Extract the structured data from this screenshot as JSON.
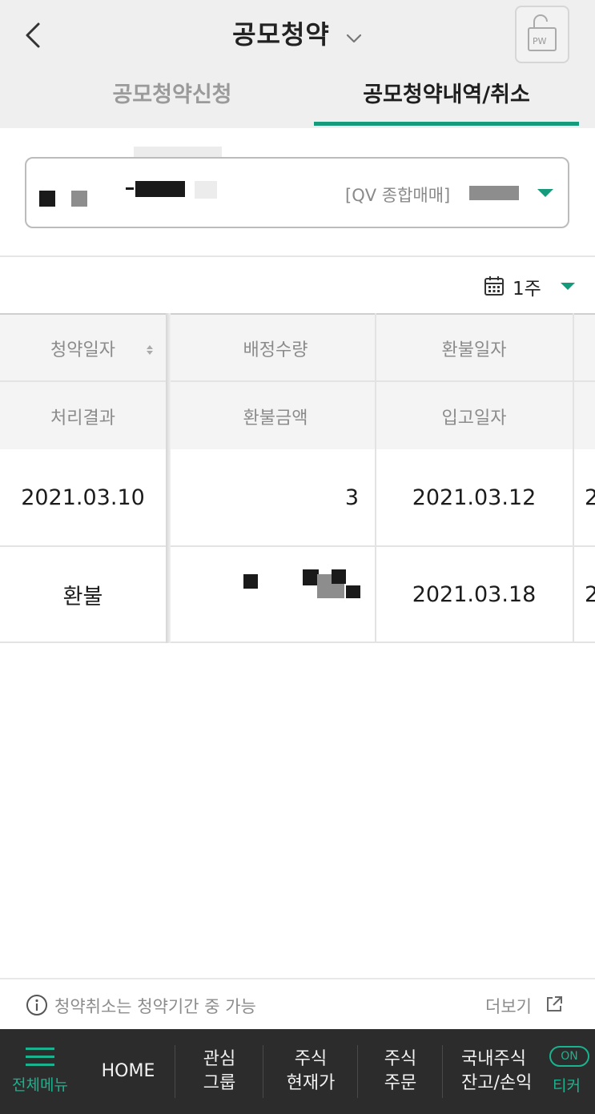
{
  "header": {
    "title": "공모청약",
    "pw_label": "PW"
  },
  "tabs": [
    {
      "label": "공모청약신청",
      "active": false
    },
    {
      "label": "공모청약내역/취소",
      "active": true
    }
  ],
  "account": {
    "type_label": "[QV 종합매매]"
  },
  "filter": {
    "period": "1주"
  },
  "table": {
    "header_row1": [
      "청약일자",
      "배정수량",
      "환불일자"
    ],
    "header_row2": [
      "처리결과",
      "환불금액",
      "입고일자"
    ],
    "row1": [
      "2021.03.10",
      "3",
      "2021.03.12",
      "2"
    ],
    "row2": [
      "환불",
      "",
      "2021.03.18",
      "2"
    ]
  },
  "info": {
    "notice": "청약취소는 청약기간 중 가능",
    "more": "더보기"
  },
  "bottom_nav": {
    "menu": "전체메뉴",
    "home": "HOME",
    "watch_line1": "관심",
    "watch_line2": "그룹",
    "price_line1": "주식",
    "price_line2": "현재가",
    "order_line1": "주식",
    "order_line2": "주문",
    "balance_line1": "국내주식",
    "balance_line2": "잔고/손익",
    "ticker_on": "ON",
    "ticker": "티커"
  },
  "colors": {
    "accent": "#169a7c",
    "header_bg": "#efefef",
    "nav_bg": "#2c2c2c"
  }
}
